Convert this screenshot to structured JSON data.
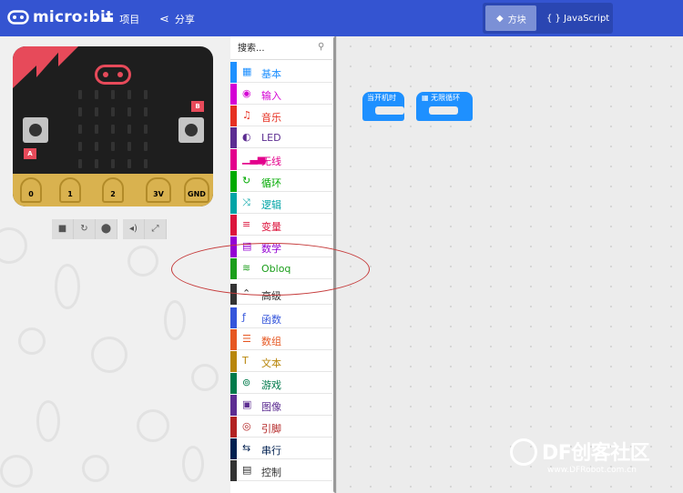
{
  "header": {
    "logo_text": "micro:bit",
    "nav": [
      {
        "label": "项目",
        "icon": "folder-icon"
      },
      {
        "label": "分享",
        "icon": "share-icon"
      }
    ],
    "toggle": {
      "blocks_label": "方块",
      "js_label": "{ } JavaScript"
    },
    "bg_color": "#3454d1"
  },
  "simulator": {
    "pins": [
      "0",
      "1",
      "2",
      "3V",
      "GND"
    ],
    "button_labels": [
      "A",
      "B"
    ],
    "toolbar_icons": [
      "stop-icon",
      "restart-icon",
      "slowmo-icon",
      "mute-icon",
      "fullscreen-icon"
    ]
  },
  "toolbox": {
    "search_placeholder": "搜索...",
    "categories": [
      {
        "label": "基本",
        "icon": "grid-icon",
        "color": "#1e90ff",
        "glyph": "▦"
      },
      {
        "label": "输入",
        "icon": "target-icon",
        "color": "#d400d4",
        "glyph": "◉"
      },
      {
        "label": "音乐",
        "icon": "headphones-icon",
        "color": "#e63022",
        "glyph": "♫"
      },
      {
        "label": "LED",
        "icon": "toggle-icon",
        "color": "#5c2d91",
        "glyph": "◐"
      },
      {
        "label": "无线",
        "icon": "signal-icon",
        "color": "#e3008c",
        "glyph": "▁▃▅"
      },
      {
        "label": "循环",
        "icon": "refresh-icon",
        "color": "#00aa00",
        "glyph": "↻"
      },
      {
        "label": "逻辑",
        "icon": "shuffle-icon",
        "color": "#00a4a6",
        "glyph": "⤨"
      },
      {
        "label": "变量",
        "icon": "list-icon",
        "color": "#dc143c",
        "glyph": "≡"
      },
      {
        "label": "数学",
        "icon": "calculator-icon",
        "color": "#9400d3",
        "glyph": "▤"
      },
      {
        "label": "Obloq",
        "icon": "wifi-icon",
        "color": "#1b9e1b",
        "glyph": "≋"
      },
      {
        "label": "高级",
        "icon": "chevron-up-icon",
        "color": "#333333",
        "glyph": "⌃"
      },
      {
        "label": "函数",
        "icon": "function-icon",
        "color": "#3455db",
        "glyph": "ƒ"
      },
      {
        "label": "数组",
        "icon": "array-icon",
        "color": "#e65722",
        "glyph": "☰"
      },
      {
        "label": "文本",
        "icon": "text-icon",
        "color": "#b8860b",
        "glyph": "T"
      },
      {
        "label": "游戏",
        "icon": "gamepad-icon",
        "color": "#007a4b",
        "glyph": "⊚"
      },
      {
        "label": "图像",
        "icon": "image-icon",
        "color": "#5c2d91",
        "glyph": "▣"
      },
      {
        "label": "引脚",
        "icon": "pin-icon",
        "color": "#b22222",
        "glyph": "◎"
      },
      {
        "label": "串行",
        "icon": "usb-icon",
        "color": "#002050",
        "glyph": "⇆"
      },
      {
        "label": "控制",
        "icon": "control-icon",
        "color": "#333333",
        "glyph": "▤"
      }
    ]
  },
  "workspace": {
    "blocks": [
      {
        "label": "当开机时"
      },
      {
        "label": "无限循环"
      }
    ]
  },
  "watermark": {
    "main": "DF创客社区",
    "sub": "www.DFRobot.com.cn"
  }
}
